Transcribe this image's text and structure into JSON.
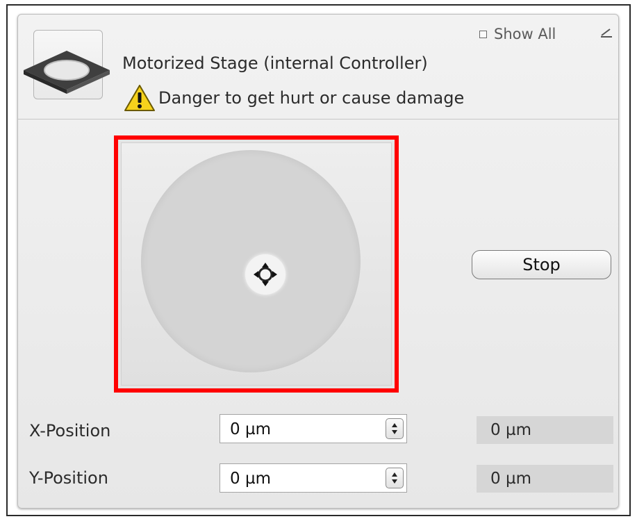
{
  "panel": {
    "title": "Motorized Stage (internal Controller)",
    "warning": "Danger to get hurt or cause damage",
    "show_all_label": "Show All",
    "icons": {
      "stage": "motorized-stage-icon",
      "warning": "warning-triangle-icon",
      "pin": "pin-icon",
      "joystick": "move-arrows-icon",
      "spinner": "spinner-up-down-icon"
    }
  },
  "joystick": {
    "highlight_color": "#ff0000",
    "handle_icon": "move-arrows-icon"
  },
  "controls": {
    "stop_label": "Stop"
  },
  "positions": [
    {
      "label": "X-Position",
      "input_value": "0 µm",
      "readout": "0 µm"
    },
    {
      "label": "Y-Position",
      "input_value": "0 µm",
      "readout": "0 µm"
    }
  ],
  "colors": {
    "highlight": "#ff0000",
    "panel_bg": "#eeeeee",
    "readout_bg": "#d6d6d6",
    "warning_yellow": "#f6d21c"
  }
}
